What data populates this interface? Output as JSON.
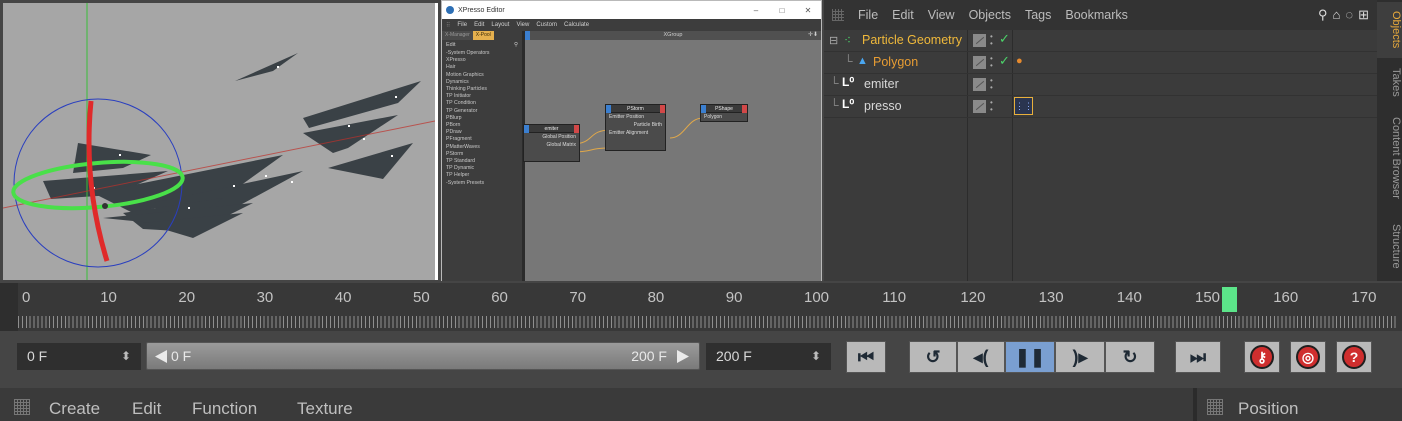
{
  "xpresso": {
    "window_title": "XPresso Editor",
    "menu": [
      "File",
      "Edit",
      "Layout",
      "View",
      "Custom",
      "Calculate"
    ],
    "tabs": [
      "X-Manager",
      "X-Pool"
    ],
    "edit_label": "Edit",
    "tree": [
      "-System Operators",
      "  XPresso",
      "  Hair",
      "  Motion Graphics",
      "  Dynamics",
      "  Thinking Particles",
      "    TP Initiator",
      "    TP Condition",
      "    TP Generator",
      "      PBlurp",
      "      PBorn",
      "      PDraw",
      "      PFragment",
      "      PMatterWaves",
      "      PStorm",
      "    TP Standard",
      "    TP Dynamic",
      "    TP Helper",
      "-System Presets"
    ],
    "canvas_title": "XGroup",
    "nodes": {
      "emiter": {
        "title": "emiter",
        "outputs": [
          "Global Position",
          "Global Matrix"
        ]
      },
      "pstorm": {
        "title": "PStorm",
        "inputs": [
          "Emitter Position",
          "Emitter Alignment"
        ],
        "outputs": [
          "Particle Birth"
        ]
      },
      "pshape": {
        "title": "PShape",
        "inputs": [
          "Polygon"
        ]
      }
    }
  },
  "objects": {
    "menu": [
      "File",
      "Edit",
      "View",
      "Objects",
      "Tags",
      "Bookmarks"
    ],
    "rows": [
      {
        "name": "Particle Geometry",
        "color": "#f0b93b"
      },
      {
        "name": "Polygon",
        "color": "#e89d33"
      },
      {
        "name": "emiter",
        "color": "#d8d8d8"
      },
      {
        "name": "presso",
        "color": "#d8d8d8"
      }
    ],
    "side_tabs": [
      "Objects",
      "Takes",
      "Content Browser",
      "Structure"
    ]
  },
  "timeline": {
    "ticks": [
      "0",
      "10",
      "20",
      "30",
      "40",
      "50",
      "60",
      "70",
      "80",
      "90",
      "100",
      "110",
      "120",
      "130",
      "140",
      "150",
      "160",
      "170"
    ],
    "current_frame_marker": 155
  },
  "transport": {
    "start_field": "0 F",
    "range_start": "0 F",
    "range_end": "200 F",
    "end_field": "200 F"
  },
  "bottom_menu": {
    "items": [
      "Create",
      "Edit",
      "Function",
      "Texture"
    ],
    "right_panel": "Position"
  }
}
